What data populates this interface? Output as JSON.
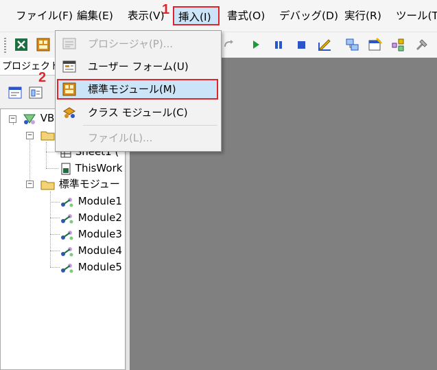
{
  "menubar": {
    "items": [
      {
        "label": "ファイル(F)"
      },
      {
        "label": "編集(E)"
      },
      {
        "label": "表示(V)"
      },
      {
        "label": "挿入(I)"
      },
      {
        "label": "書式(O)"
      },
      {
        "label": "デバッグ(D)"
      },
      {
        "label": "実行(R)"
      },
      {
        "label": "ツール(T)"
      }
    ]
  },
  "annotations": {
    "step1": "1",
    "step2": "2",
    "accent": "#e0242b"
  },
  "insert_menu": {
    "items": [
      {
        "label": "プロシージャ(P)...",
        "enabled": false,
        "icon": "procedure-icon"
      },
      {
        "label": "ユーザー フォーム(U)",
        "enabled": true,
        "icon": "userform-icon"
      },
      {
        "label": "標準モジュール(M)",
        "enabled": true,
        "selected": true,
        "icon": "module-icon"
      },
      {
        "label": "クラス モジュール(C)",
        "enabled": true,
        "icon": "class-module-icon"
      },
      {
        "label": "ファイル(L)...",
        "enabled": false,
        "icon": ""
      }
    ]
  },
  "project_pane": {
    "title": "プロジェクト -",
    "tree": {
      "root": "VB",
      "sheet": "Sheet1 (",
      "workbook": "ThisWork",
      "modules_folder": "標準モジュー",
      "modules": [
        "Module1",
        "Module2",
        "Module3",
        "Module4",
        "Module5"
      ]
    }
  },
  "colors": {
    "highlight": "#cce4f7",
    "workspace": "#808080"
  }
}
